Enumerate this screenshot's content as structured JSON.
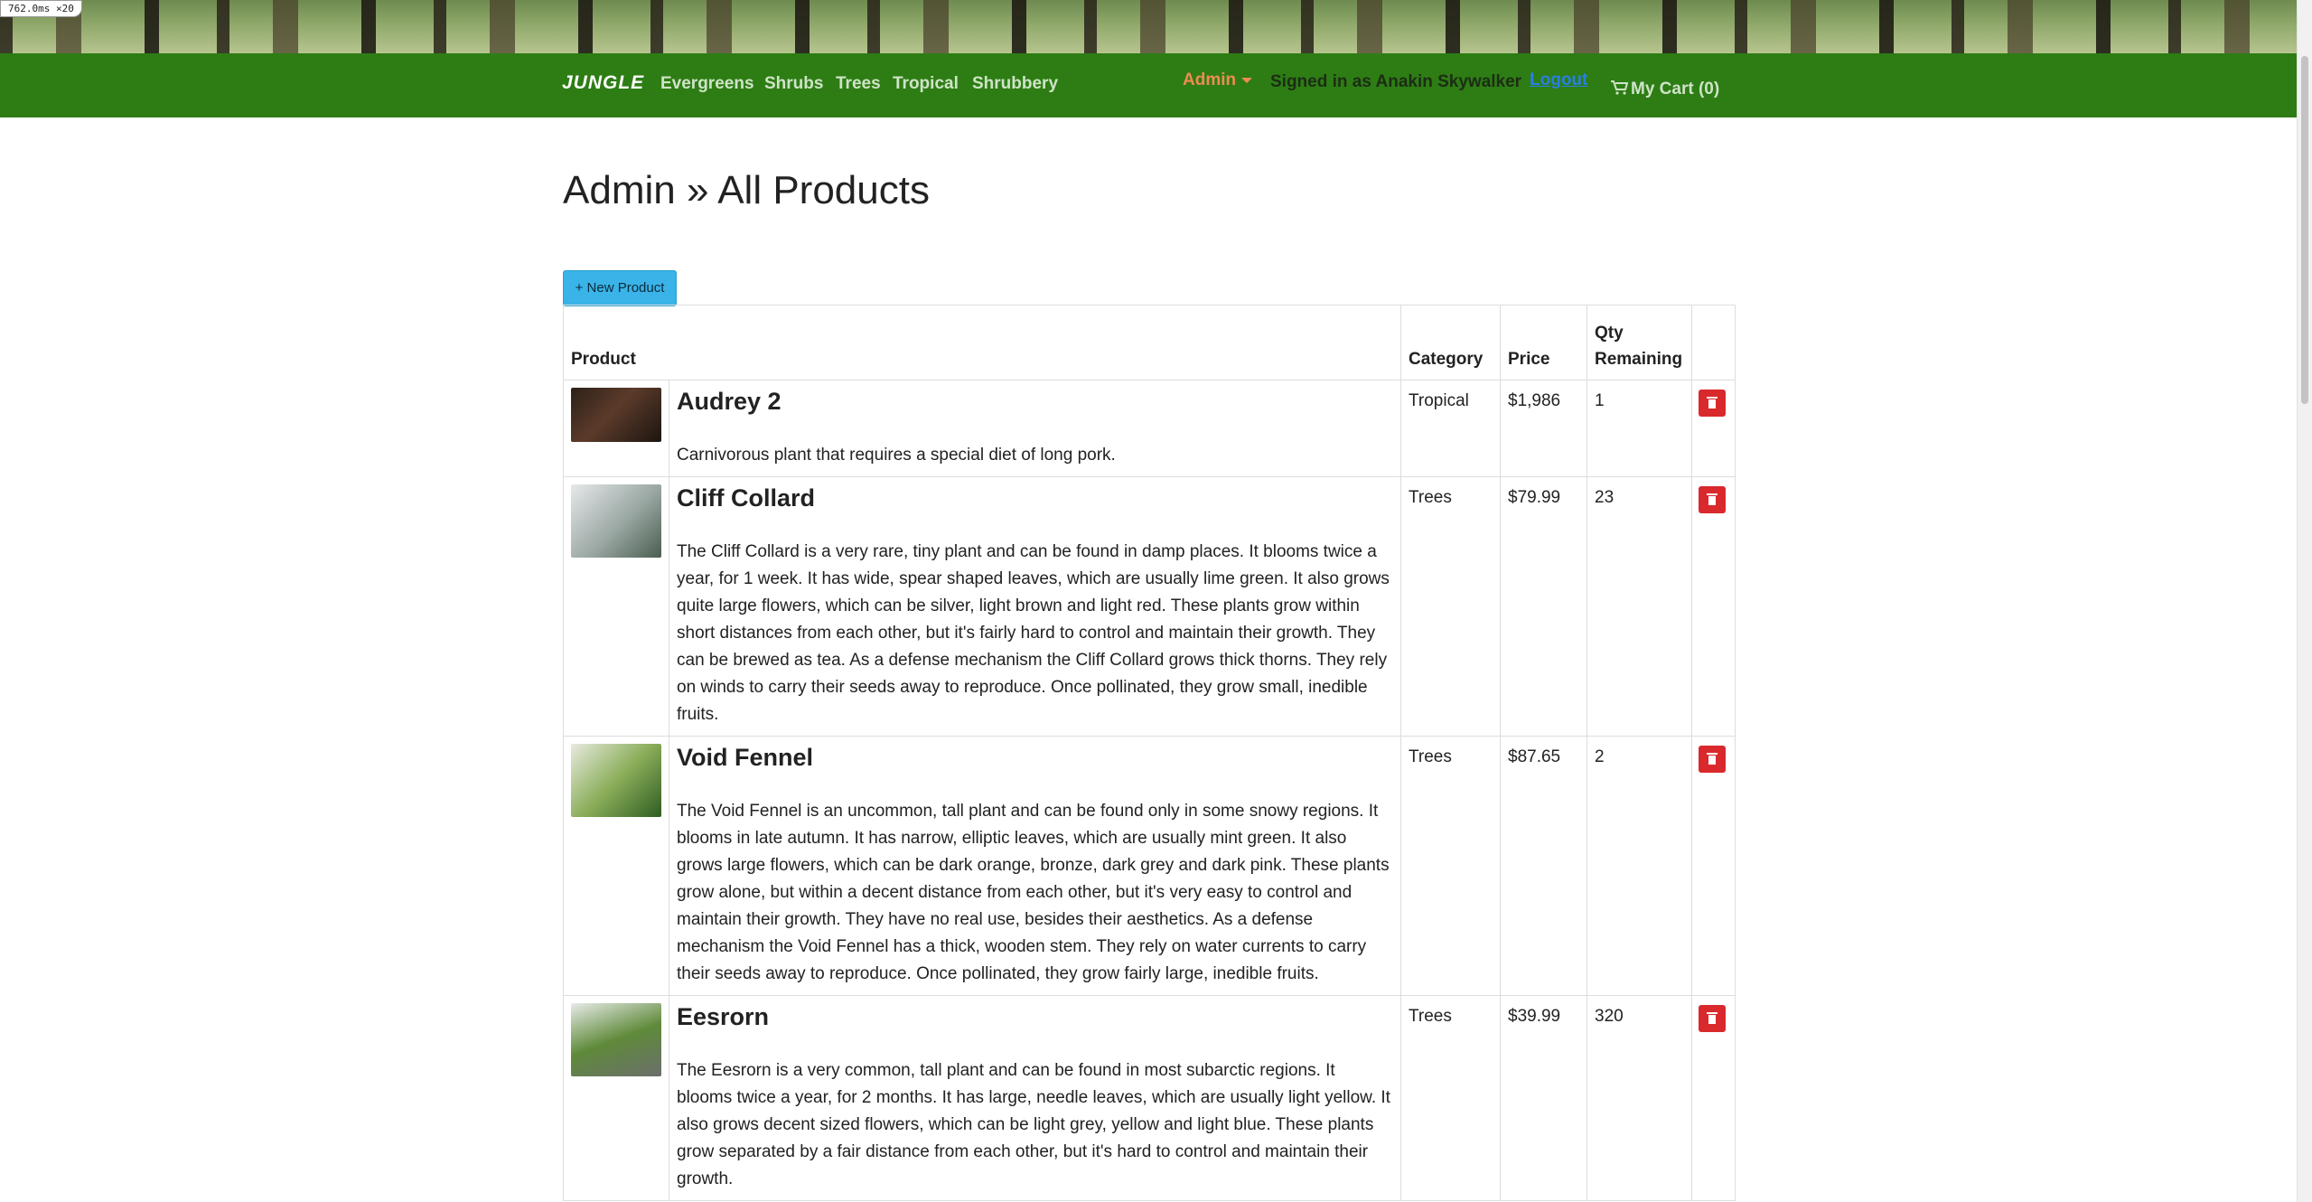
{
  "debug": {
    "render_time": "762.0ms ×20"
  },
  "navbar": {
    "brand": "JUNGLE",
    "links": [
      "Evergreens",
      "Shrubs",
      "Trees",
      "Tropical",
      "Shrubbery"
    ],
    "admin_label": "Admin",
    "signed_in": "Signed in as Anakin Skywalker",
    "logout": "Logout",
    "cart": "My Cart (0)"
  },
  "page": {
    "title": "Admin » All Products",
    "new_product": "+ New Product"
  },
  "table": {
    "headers": {
      "product": "Product",
      "category": "Category",
      "price": "Price",
      "qty": "Qty Remaining"
    },
    "rows": [
      {
        "name": "Audrey 2",
        "description": "Carnivorous plant that requires a special diet of long pork.",
        "category": "Tropical",
        "price": "$1,986",
        "qty": "1"
      },
      {
        "name": "Cliff Collard",
        "description": "The Cliff Collard is a very rare, tiny plant and can be found in damp places. It blooms twice a year, for 1 week. It has wide, spear shaped leaves, which are usually lime green. It also grows quite large flowers, which can be silver, light brown and light red. These plants grow within short distances from each other, but it's fairly hard to control and maintain their growth. They can be brewed as tea. As a defense mechanism the Cliff Collard grows thick thorns. They rely on winds to carry their seeds away to reproduce. Once pollinated, they grow small, inedible fruits.",
        "category": "Trees",
        "price": "$79.99",
        "qty": "23"
      },
      {
        "name": "Void Fennel",
        "description": "The Void Fennel is an uncommon, tall plant and can be found only in some snowy regions. It blooms in late autumn. It has narrow, elliptic leaves, which are usually mint green. It also grows large flowers, which can be dark orange, bronze, dark grey and dark pink. These plants grow alone, but within a decent distance from each other, but it's very easy to control and maintain their growth. They have no real use, besides their aesthetics. As a defense mechanism the Void Fennel has a thick, wooden stem. They rely on water currents to carry their seeds away to reproduce. Once pollinated, they grow fairly large, inedible fruits.",
        "category": "Trees",
        "price": "$87.65",
        "qty": "2"
      },
      {
        "name": "Eesrorn",
        "description": "The Eesrorn is a very common, tall plant and can be found in most subarctic regions. It blooms twice a year, for 2 months. It has large, needle leaves, which are usually light yellow. It also grows decent sized flowers, which can be light grey, yellow and light blue. These plants grow separated by a fair distance from each other, but it's hard to control and maintain their growth.",
        "category": "Trees",
        "price": "$39.99",
        "qty": "320"
      }
    ]
  }
}
